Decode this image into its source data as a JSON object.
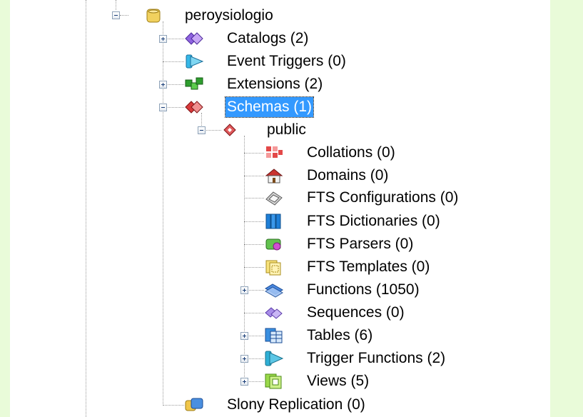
{
  "tree": {
    "db": {
      "label": "peroysiologio",
      "icon": "database-icon"
    },
    "catalogs": {
      "label": "Catalogs (2)",
      "icon": "catalogs-icon"
    },
    "event_triggers": {
      "label": "Event Triggers (0)",
      "icon": "event-triggers-icon"
    },
    "extensions": {
      "label": "Extensions (2)",
      "icon": "extensions-icon"
    },
    "schemas": {
      "label": "Schemas (1)",
      "icon": "schemas-icon",
      "selected": true
    },
    "public": {
      "label": "public",
      "icon": "schema-icon"
    },
    "collations": {
      "label": "Collations (0)",
      "icon": "collations-icon"
    },
    "domains": {
      "label": "Domains (0)",
      "icon": "domains-icon"
    },
    "fts_configurations": {
      "label": "FTS Configurations (0)",
      "icon": "fts-configurations-icon"
    },
    "fts_dictionaries": {
      "label": "FTS Dictionaries (0)",
      "icon": "fts-dictionaries-icon"
    },
    "fts_parsers": {
      "label": "FTS Parsers (0)",
      "icon": "fts-parsers-icon"
    },
    "fts_templates": {
      "label": "FTS Templates (0)",
      "icon": "fts-templates-icon"
    },
    "functions": {
      "label": "Functions (1050)",
      "icon": "functions-icon"
    },
    "sequences": {
      "label": "Sequences (0)",
      "icon": "sequences-icon"
    },
    "tables": {
      "label": "Tables (6)",
      "icon": "tables-icon"
    },
    "trigger_functions": {
      "label": "Trigger Functions (2)",
      "icon": "trigger-functions-icon"
    },
    "views": {
      "label": "Views (5)",
      "icon": "views-icon"
    },
    "slony": {
      "label": "Slony Replication (0)",
      "icon": "slony-replication-icon"
    }
  },
  "colors": {
    "selection": "#3399ff",
    "panel_background": "#e9fbd9"
  }
}
